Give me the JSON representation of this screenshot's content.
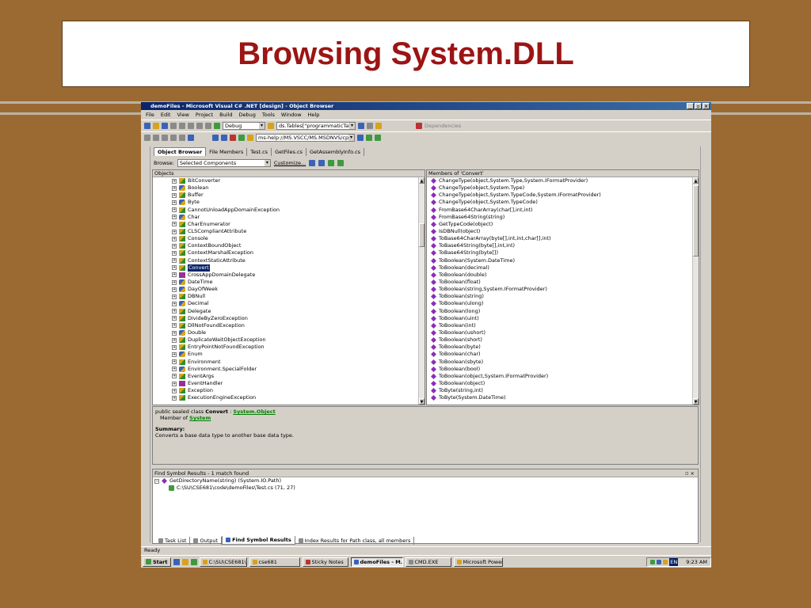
{
  "slide": {
    "title": "Browsing System.DLL"
  },
  "window": {
    "title": "demoFiles - Microsoft Visual C# .NET [design] - Object Browser",
    "minimize": "_",
    "maximize": "▫",
    "close": "×"
  },
  "menu": [
    "File",
    "Edit",
    "View",
    "Project",
    "Build",
    "Debug",
    "Tools",
    "Window",
    "Help"
  ],
  "toolbar": {
    "dependencies": "Dependencies",
    "config": "Debug",
    "find_combo": "ds.Tables[\"programmaticTable\"]",
    "url": "ms-help://MS.VSCC/MS.MSDNVS/cpref/htm"
  },
  "doc_tabs": [
    "Object Browser",
    "File Members",
    "Test.cs",
    "GetFiles.cs",
    "GetAssemblyInfo.cs"
  ],
  "browse": {
    "label": "Browse:",
    "value": "Selected Components",
    "customize": "Customize..."
  },
  "objects_header": "Objects",
  "objects": [
    {
      "name": "BitConverter",
      "kind": "cls"
    },
    {
      "name": "Boolean",
      "kind": "struct"
    },
    {
      "name": "Buffer",
      "kind": "cls"
    },
    {
      "name": "Byte",
      "kind": "struct"
    },
    {
      "name": "CannotUnloadAppDomainException",
      "kind": "cls"
    },
    {
      "name": "Char",
      "kind": "struct"
    },
    {
      "name": "CharEnumerator",
      "kind": "cls"
    },
    {
      "name": "CLSCompliantAttribute",
      "kind": "cls"
    },
    {
      "name": "Console",
      "kind": "cls"
    },
    {
      "name": "ContextBoundObject",
      "kind": "cls"
    },
    {
      "name": "ContextMarshalException",
      "kind": "cls"
    },
    {
      "name": "ContextStaticAttribute",
      "kind": "cls"
    },
    {
      "name": "Convert",
      "kind": "cls",
      "selected": true
    },
    {
      "name": "CrossAppDomainDelegate",
      "kind": "del"
    },
    {
      "name": "DateTime",
      "kind": "struct"
    },
    {
      "name": "DayOfWeek",
      "kind": "struct"
    },
    {
      "name": "DBNull",
      "kind": "cls"
    },
    {
      "name": "Decimal",
      "kind": "struct"
    },
    {
      "name": "Delegate",
      "kind": "cls"
    },
    {
      "name": "DivideByZeroException",
      "kind": "cls"
    },
    {
      "name": "DllNotFoundException",
      "kind": "cls"
    },
    {
      "name": "Double",
      "kind": "struct"
    },
    {
      "name": "DuplicateWaitObjectException",
      "kind": "cls"
    },
    {
      "name": "EntryPointNotFoundException",
      "kind": "cls"
    },
    {
      "name": "Enum",
      "kind": "struct"
    },
    {
      "name": "Environment",
      "kind": "cls"
    },
    {
      "name": "Environment.SpecialFolder",
      "kind": "struct"
    },
    {
      "name": "EventArgs",
      "kind": "cls"
    },
    {
      "name": "EventHandler",
      "kind": "del"
    },
    {
      "name": "Exception",
      "kind": "cls"
    },
    {
      "name": "ExecutionEngineException",
      "kind": "cls"
    }
  ],
  "members_header": "Members of 'Convert'",
  "members": [
    "ChangeType(object,System.Type,System.IFormatProvider)",
    "ChangeType(object,System.Type)",
    "ChangeType(object,System.TypeCode,System.IFormatProvider)",
    "ChangeType(object,System.TypeCode)",
    "FromBase64CharArray(char[],int,int)",
    "FromBase64String(string)",
    "GetTypeCode(object)",
    "IsDBNull(object)",
    "ToBase64CharArray(byte[],int,int,char[],int)",
    "ToBase64String(byte[],int,int)",
    "ToBase64String(byte[])",
    "ToBoolean(System.DateTime)",
    "ToBoolean(decimal)",
    "ToBoolean(double)",
    "ToBoolean(float)",
    "ToBoolean(string,System.IFormatProvider)",
    "ToBoolean(string)",
    "ToBoolean(ulong)",
    "ToBoolean(long)",
    "ToBoolean(uint)",
    "ToBoolean(int)",
    "ToBoolean(ushort)",
    "ToBoolean(short)",
    "ToBoolean(byte)",
    "ToBoolean(char)",
    "ToBoolean(sbyte)",
    "ToBoolean(bool)",
    "ToBoolean(object,System.IFormatProvider)",
    "ToBoolean(object)",
    "ToByte(string,int)",
    "ToByte(System.DateTime)"
  ],
  "description": {
    "signature_prefix": "public sealed class",
    "class_name": "Convert",
    "separator": ":",
    "base_class": "System.Object",
    "member_of_label": "Member of",
    "member_of": "System",
    "summary_label": "Summary:",
    "summary": "Converts a base data type to another base data type."
  },
  "find_results": {
    "title": "Find Symbol Results - 1 match found",
    "controls": "▫ ×",
    "result": "GetDirectoryName(string) (System.IO.Path)",
    "location": "C:\\SU\\CSE681\\code\\demoFiles\\Test.cs (71, 27)"
  },
  "bottom_tabs": [
    "Task List",
    "Output",
    "Find Symbol Results",
    "Index Results for Path class, all members"
  ],
  "status": "Ready",
  "taskbar": {
    "start": "Start",
    "tasks": [
      "C:\\SU\\CSE681\\...",
      "cse681",
      "Sticky Notes",
      "demoFiles - M...",
      "CMD.EXE",
      "Microsoft Power..."
    ],
    "active_index": 3,
    "lang": "EN",
    "time": "9:23 AM"
  }
}
